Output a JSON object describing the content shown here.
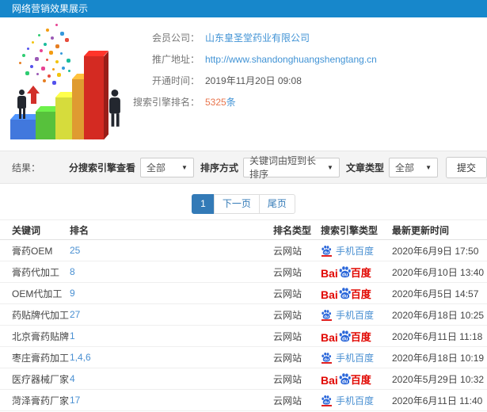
{
  "header": {
    "title": "网络营销效果展示"
  },
  "info": {
    "company_label": "会员公司：",
    "company_value": "山东皇圣堂药业有限公司",
    "url_label": "推广地址：",
    "url_value": "http://www.shandonghuangshengtang.cn",
    "open_time_label": "开通时间：",
    "open_time_value": "2019年11月20日 09:08",
    "rank_count_label": "搜索引擎排名：",
    "rank_count_value": "5325",
    "rank_count_suffix": "条"
  },
  "filters": {
    "result_label": "结果：",
    "engine_label": "分搜索引擎查看",
    "engine_value": "全部",
    "sort_label": "排序方式",
    "sort_value": "关键词由短到长排序",
    "article_label": "文章类型",
    "article_value": "全部",
    "submit_label": "提交",
    "arrow": "▼"
  },
  "pagination": {
    "current": "1",
    "next": "下一页",
    "last": "尾页"
  },
  "table": {
    "headers": [
      "关键词",
      "排名",
      "排名类型",
      "搜索引擎类型",
      "最新更新时间"
    ],
    "rows": [
      {
        "keyword": "膏药OEM",
        "rank": "25",
        "rank_type": "云网站",
        "engine": "mobile-baidu",
        "engine_label": "手机百度",
        "updated": "2020年6月9日 17:50"
      },
      {
        "keyword": "膏药代加工",
        "rank": "8",
        "rank_type": "云网站",
        "engine": "baidu",
        "engine_label": "Baidu百度",
        "updated": "2020年6月10日 13:40"
      },
      {
        "keyword": "OEM代加工",
        "rank": "9",
        "rank_type": "云网站",
        "engine": "baidu",
        "engine_label": "Baidu百度",
        "updated": "2020年6月5日 14:57"
      },
      {
        "keyword": "药贴牌代加工",
        "rank": "27",
        "rank_type": "云网站",
        "engine": "mobile-baidu",
        "engine_label": "手机百度",
        "updated": "2020年6月18日 10:25"
      },
      {
        "keyword": "北京膏药贴牌",
        "rank": "1",
        "rank_type": "云网站",
        "engine": "baidu",
        "engine_label": "Baidu百度",
        "updated": "2020年6月11日 11:18"
      },
      {
        "keyword": "枣庄膏药加工",
        "rank": "1,4,6",
        "rank_type": "云网站",
        "engine": "mobile-baidu",
        "engine_label": "手机百度",
        "updated": "2020年6月18日 10:19"
      },
      {
        "keyword": "医疗器械厂家",
        "rank": "4",
        "rank_type": "云网站",
        "engine": "baidu",
        "engine_label": "Baidu百度",
        "updated": "2020年5月29日 10:32"
      },
      {
        "keyword": "菏泽膏药厂家",
        "rank": "17",
        "rank_type": "云网站",
        "engine": "mobile-baidu",
        "engine_label": "手机百度",
        "updated": "2020年6月11日 11:40"
      }
    ]
  },
  "engine_logos": {
    "baidu_bai": "Bai",
    "baidu_du": "du",
    "baidu_cn": "百度",
    "mobile_label": "手机百度"
  },
  "colors": {
    "header_bg": "#1787cb",
    "link_blue": "#4193d5",
    "highlight_orange": "#e8744c",
    "pagination_blue": "#337ab7",
    "baidu_red": "#e10600",
    "baidu_blue": "#2a66d9",
    "bar_colors": [
      "#4178dd",
      "#57c13c",
      "#d6dc3c",
      "#df9b31",
      "#d42a22"
    ]
  }
}
